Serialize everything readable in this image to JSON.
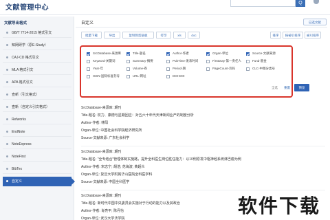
{
  "app": {
    "title": "文献管理中心",
    "search_btn": "Q"
  },
  "sidebar": {
    "title": "文献导出格式",
    "items": [
      {
        "label": "GB/T 7714-2015 格式引文"
      },
      {
        "label": "知网研学（原E-Study）"
      },
      {
        "label": "CAJ-CD 格式引文"
      },
      {
        "label": "MLA 格式引文"
      },
      {
        "label": "APA 格式引文"
      },
      {
        "label": "查新（引文格式）"
      },
      {
        "label": "查新（自定义引文格式）"
      },
      {
        "label": "Refworks"
      },
      {
        "label": "EndNote"
      },
      {
        "label": "NoteExpress"
      },
      {
        "label": "NoteFirst"
      },
      {
        "label": "BibTex"
      },
      {
        "label": "自定义"
      }
    ]
  },
  "panel": {
    "title": "自定义",
    "settings_label": "已选文献"
  },
  "toolbar": {
    "left": [
      "批量下载",
      "导出",
      "复制到剪贴板",
      "打印",
      "xls",
      "doc"
    ],
    "right": [
      "排序",
      "按被引排序",
      "被引排序"
    ]
  },
  "fields": [
    [
      "SrcDatabase-来源库",
      "Title-题名",
      "Author-作者",
      "Organ-单位",
      "Source-文献来源"
    ],
    [
      "Keyword-关键词",
      "Summary-摘要",
      "PubTime-发表时间",
      "FirstDuty-第一责任人",
      "Fund-基金"
    ],
    [
      "Year-年",
      "Volume-卷",
      "Period-期",
      "PageCount-页码",
      "CLC-中图分类号"
    ],
    [
      "ISSN-国际标准刊号",
      "URL-网址",
      "DOI-DOI",
      "",
      ""
    ]
  ],
  "fields_checked": [
    [
      true,
      true,
      true,
      true,
      true
    ],
    [
      false,
      false,
      false,
      false,
      false
    ],
    [
      false,
      false,
      false,
      false,
      false
    ],
    [
      false,
      false,
      false,
      false,
      false
    ]
  ],
  "actions": {
    "select_all": "全选",
    "clear": "重置",
    "preview": "预览"
  },
  "records": [
    [
      "SrcDatabase-来源库: 期刊",
      "Title-题名: 权力、康德与星期回应：对五六十年代天津新闻业产的制度分析",
      "Author-作者: 林阳",
      "Organ-单位: 中国社会科学院经济研究所",
      "Source-文献来源: 广东社会科学"
    ],
    [
      "SrcDatabase-来源库: 期刊",
      "Title-题名: \"全专结合\"管理体制实施路，提升全科医生岗位胜任能力：以10例原发中枢神经系统淋巴瘤为例",
      "Author-作者: 宋志宁; 胡浩; 范海波; 黄超众",
      "Organ-单位: 复旦大学附属华山医院全科医学科",
      "Source-文献来源: 中国全科医学"
    ],
    [
      "SrcDatabase-来源库: 期刊",
      "Title-题名: 新时代中国中央委员会实施对于行动的能力以及其政治",
      "Author-作者: 肖亮平; 陈丹怡",
      "Organ-单位: 武汉大学法学院"
    ]
  ],
  "watermark": "软件下载"
}
